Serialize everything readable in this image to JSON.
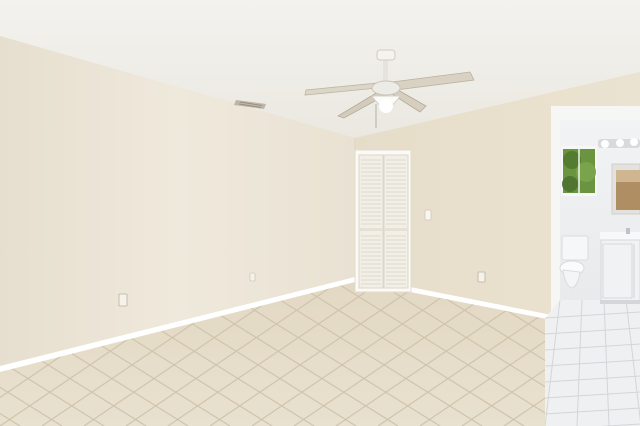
{
  "scene": {
    "kind": "photo",
    "subject": "empty-room",
    "colors": {
      "ceiling": "#f1efea",
      "left_wall": "#ece6d8",
      "right_wall": "#e8dfcc",
      "floor_tile": "#e5dcc8",
      "grout": "#cfc4ad",
      "baseboard": "#ffffff",
      "closet_door": "#f4f2ec",
      "bathroom_wall": "#eef0f2",
      "bathroom_floor": "#f2f3f4",
      "vanity": "#f3f4f5",
      "window_foliage": "#5f8a3a",
      "fan_blade": "#d8d2c4"
    },
    "elements": [
      "ceiling-fan",
      "air-vent",
      "closet-door",
      "bathroom-doorway",
      "toilet",
      "vanity",
      "mirror",
      "window",
      "vanity-lights",
      "outlets",
      "light-switch"
    ]
  }
}
